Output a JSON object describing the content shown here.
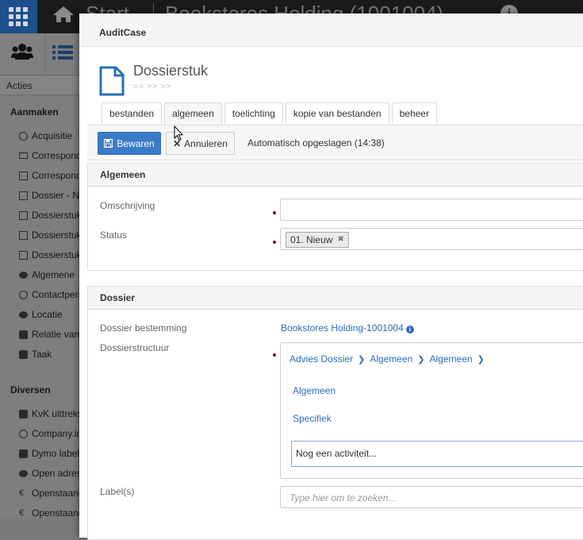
{
  "topbar": {
    "title": "Start",
    "company": "Bookstores Holding (1001004)"
  },
  "sidebar": {
    "acties_label": "Acties",
    "aanmaken_header": "Aanmaken",
    "aanmaken_items": [
      {
        "label": "Acquisitie",
        "icon": "target-icon"
      },
      {
        "label": "Correspondentie",
        "icon": "envelope-icon"
      },
      {
        "label": "Correspondentie",
        "icon": "file-icon"
      },
      {
        "label": "Dossier - Nieuw",
        "icon": "file-text-icon"
      },
      {
        "label": "Dossierstuk",
        "icon": "file-text-icon"
      },
      {
        "label": "Dossierstuk",
        "icon": "file-text-icon"
      },
      {
        "label": "Dossierstuk",
        "icon": "file-text-icon"
      },
      {
        "label": "Algemene",
        "icon": "user-icon"
      },
      {
        "label": "Contactpersoon",
        "icon": "contact-icon"
      },
      {
        "label": "Locatie",
        "icon": "location-icon"
      },
      {
        "label": "Relatie van",
        "icon": "address-card-icon"
      },
      {
        "label": "Taak",
        "icon": "task-icon"
      }
    ],
    "diversen_header": "Diversen",
    "diversen_items": [
      {
        "label": "KvK uittreksel",
        "icon": "folder-icon"
      },
      {
        "label": "Company.info",
        "icon": "search-icon"
      },
      {
        "label": "Dymo label",
        "icon": "print-icon"
      },
      {
        "label": "Open adres",
        "icon": "person-pin-icon"
      },
      {
        "label": "Openstaand",
        "icon": "euro-icon"
      },
      {
        "label": "Openstaand",
        "icon": "euro-icon"
      }
    ]
  },
  "modal": {
    "header": "AuditCase",
    "doc_title": "Dossierstuk",
    "doc_crumbs": ">> >> >>",
    "tabs": [
      "bestanden",
      "algemeen",
      "toelichting",
      "kopie van bestanden",
      "beheer"
    ],
    "active_tab": "algemeen",
    "save_label": "Bewaren",
    "cancel_label": "Annuleren",
    "autosave_text": "Automatisch opgeslagen (14:38)",
    "algemeen": {
      "title": "Algemeen",
      "omschrijving_label": "Omschrijving",
      "omschrijving_value": "",
      "status_label": "Status",
      "status_value": "01. Nieuw"
    },
    "dossier": {
      "title": "Dossier",
      "bestemming_label": "Dossier bestemming",
      "bestemming_value": "Bookstores Holding-1001004",
      "structuur_label": "Dossierstructuur",
      "crumbs": [
        "Advies Dossier",
        "Algemeen",
        "Algemeen"
      ],
      "options": [
        "Algemeen",
        "Specifiek"
      ],
      "activity_value": "Nog een activiteit...",
      "labels_label": "Label(s)",
      "labels_placeholder": "Type hier om te zoeken..."
    }
  },
  "colors": {
    "primary": "#3a7bc8",
    "link": "#2a6ebb",
    "required": "#7a1111",
    "topbar_accent": "#1d4f8a"
  }
}
